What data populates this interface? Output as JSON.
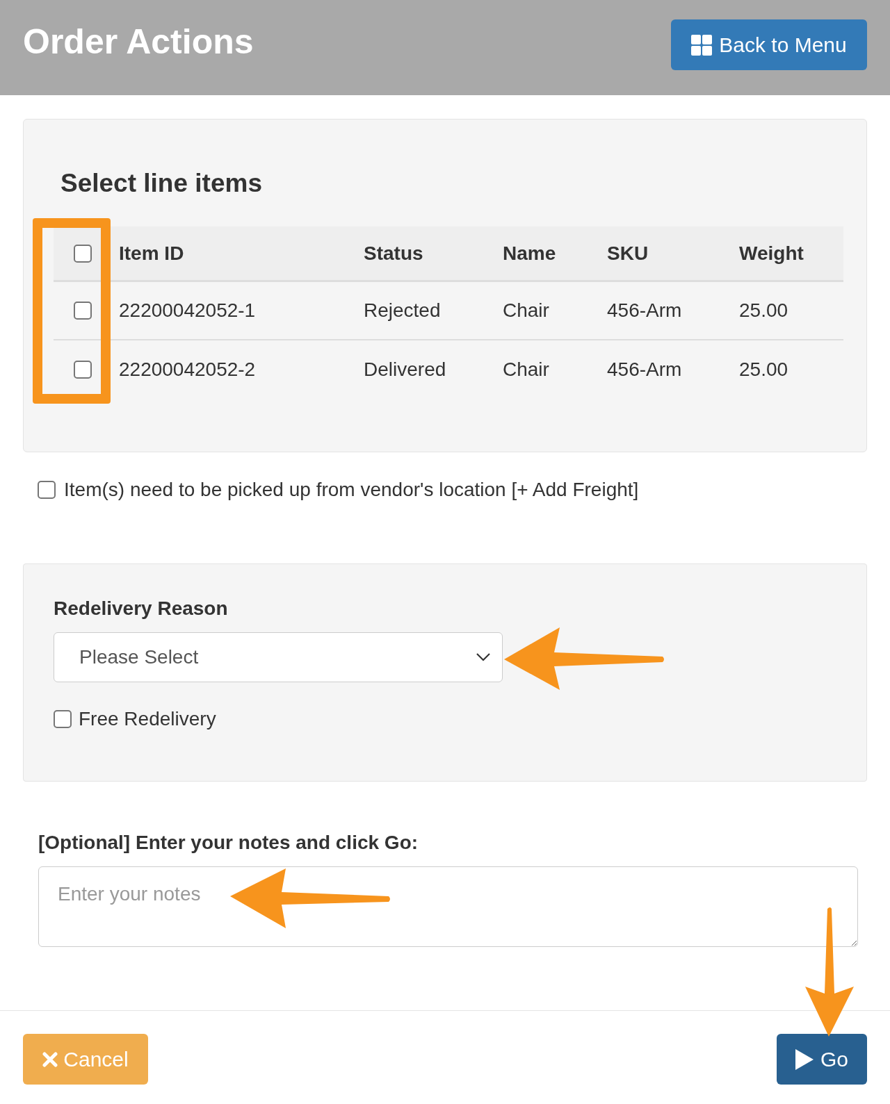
{
  "header": {
    "title": "Order Actions",
    "back_button": "Back to Menu"
  },
  "line_items": {
    "heading": "Select line items",
    "select_all": {
      "checked": false
    },
    "columns": [
      "Item ID",
      "Status",
      "Name",
      "SKU",
      "Weight"
    ],
    "rows": [
      {
        "checked": false,
        "cells": [
          "22200042052-1",
          "Rejected",
          "Chair",
          "456-Arm",
          "25.00"
        ]
      },
      {
        "checked": false,
        "cells": [
          "22200042052-2",
          "Delivered",
          "Chair",
          "456-Arm",
          "25.00"
        ]
      }
    ]
  },
  "pickup": {
    "label": "Item(s) need to be picked up from vendor's location [+ Add Freight]",
    "checked": false
  },
  "redelivery": {
    "label": "Redelivery Reason",
    "select": {
      "value": "Please Select"
    },
    "free": {
      "label": "Free Redelivery",
      "checked": false
    }
  },
  "notes": {
    "label": "[Optional] Enter your notes and click Go:",
    "placeholder": "Enter your notes"
  },
  "footer": {
    "cancel": "Cancel",
    "go": "Go"
  }
}
